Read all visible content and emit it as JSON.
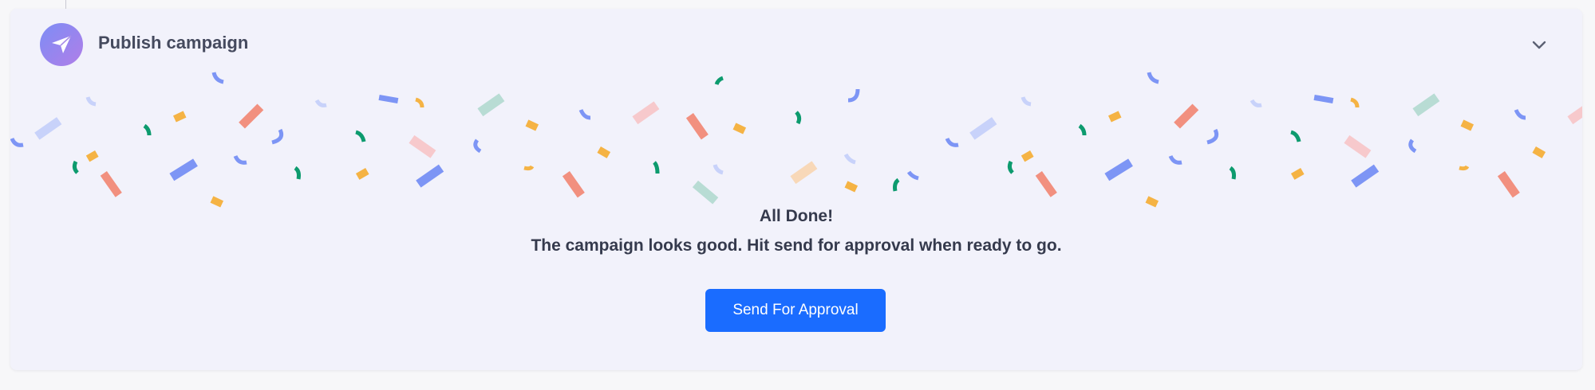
{
  "card": {
    "title": "Publish campaign",
    "avatar_icon": "paper-plane-icon",
    "collapse_icon": "chevron-down-icon"
  },
  "message": {
    "title": "All Done!",
    "body": "The campaign looks good. Hit send for approval when ready to go."
  },
  "actions": {
    "send_label": "Send For Approval"
  },
  "colors": {
    "primary": "#1a6cff",
    "card_bg": "#f2f2fb",
    "confetti": [
      "#7d95f5",
      "#f2907f",
      "#f5b344",
      "#0d9b6e",
      "#f7c9cc",
      "#c8d2fa",
      "#b8dcd4",
      "#f8d8b8"
    ]
  }
}
